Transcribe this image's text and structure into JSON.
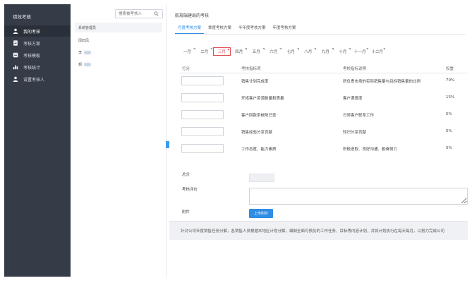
{
  "sidebar": {
    "title": "绩效考核",
    "items": [
      {
        "label": "我的考核",
        "icon": "person-icon",
        "active": true
      },
      {
        "label": "考核方案",
        "icon": "document-icon",
        "active": false
      },
      {
        "label": "考核模板",
        "icon": "template-icon",
        "active": false
      },
      {
        "label": "考核统计",
        "icon": "chart-icon",
        "active": false
      },
      {
        "label": "设置考核人",
        "icon": "user-icon",
        "active": false
      }
    ]
  },
  "middle": {
    "search_placeholder": "搜索被考核人",
    "items": [
      "系统管理员",
      "邱旧凤",
      "李",
      "郝"
    ]
  },
  "main": {
    "title": "航规端建局的考核",
    "tabs": [
      "月度考核方案",
      "季度考核方案",
      "半年度考核方案",
      "年度考核方案"
    ],
    "active_tab": 0,
    "months": [
      "一月",
      "二月",
      "三月",
      "四月",
      "五月",
      "六月",
      "七月",
      "八月",
      "九月",
      "十月",
      "十一月",
      "十二月"
    ],
    "active_month": 2,
    "table": {
      "headers": [
        "打分",
        "考核指标项",
        "考核指标说明",
        "权重"
      ],
      "rows": [
        {
          "item": "销售计划完成率",
          "desc": "所负责市场的实际销售量与目标销售量的比例",
          "weight": "70%"
        },
        {
          "item": "开拓客户资源数量和质量",
          "desc": "客户满意度",
          "weight": "15%"
        },
        {
          "item": "客户回款系统阳已查",
          "desc": "日常客户联系工作",
          "weight": "5%"
        },
        {
          "item": "销售经验分享贡献",
          "desc": "知识分享贡献",
          "weight": "5%"
        },
        {
          "item": "工作态度、能力素质",
          "desc": "积极进取、良好沟通、勤奋努力",
          "weight": "5%"
        }
      ]
    },
    "total_label": "总分",
    "eval_label": "考核评价",
    "attachment_label": "附件",
    "upload_label": "上传附件",
    "footer_note": "针对公司年度销售任务分解，各销售人员根据本地区计划分解，编制全面可预见的工作任务、目标等内容计划，并将计划执行在每天每月，以努力完成公司"
  }
}
